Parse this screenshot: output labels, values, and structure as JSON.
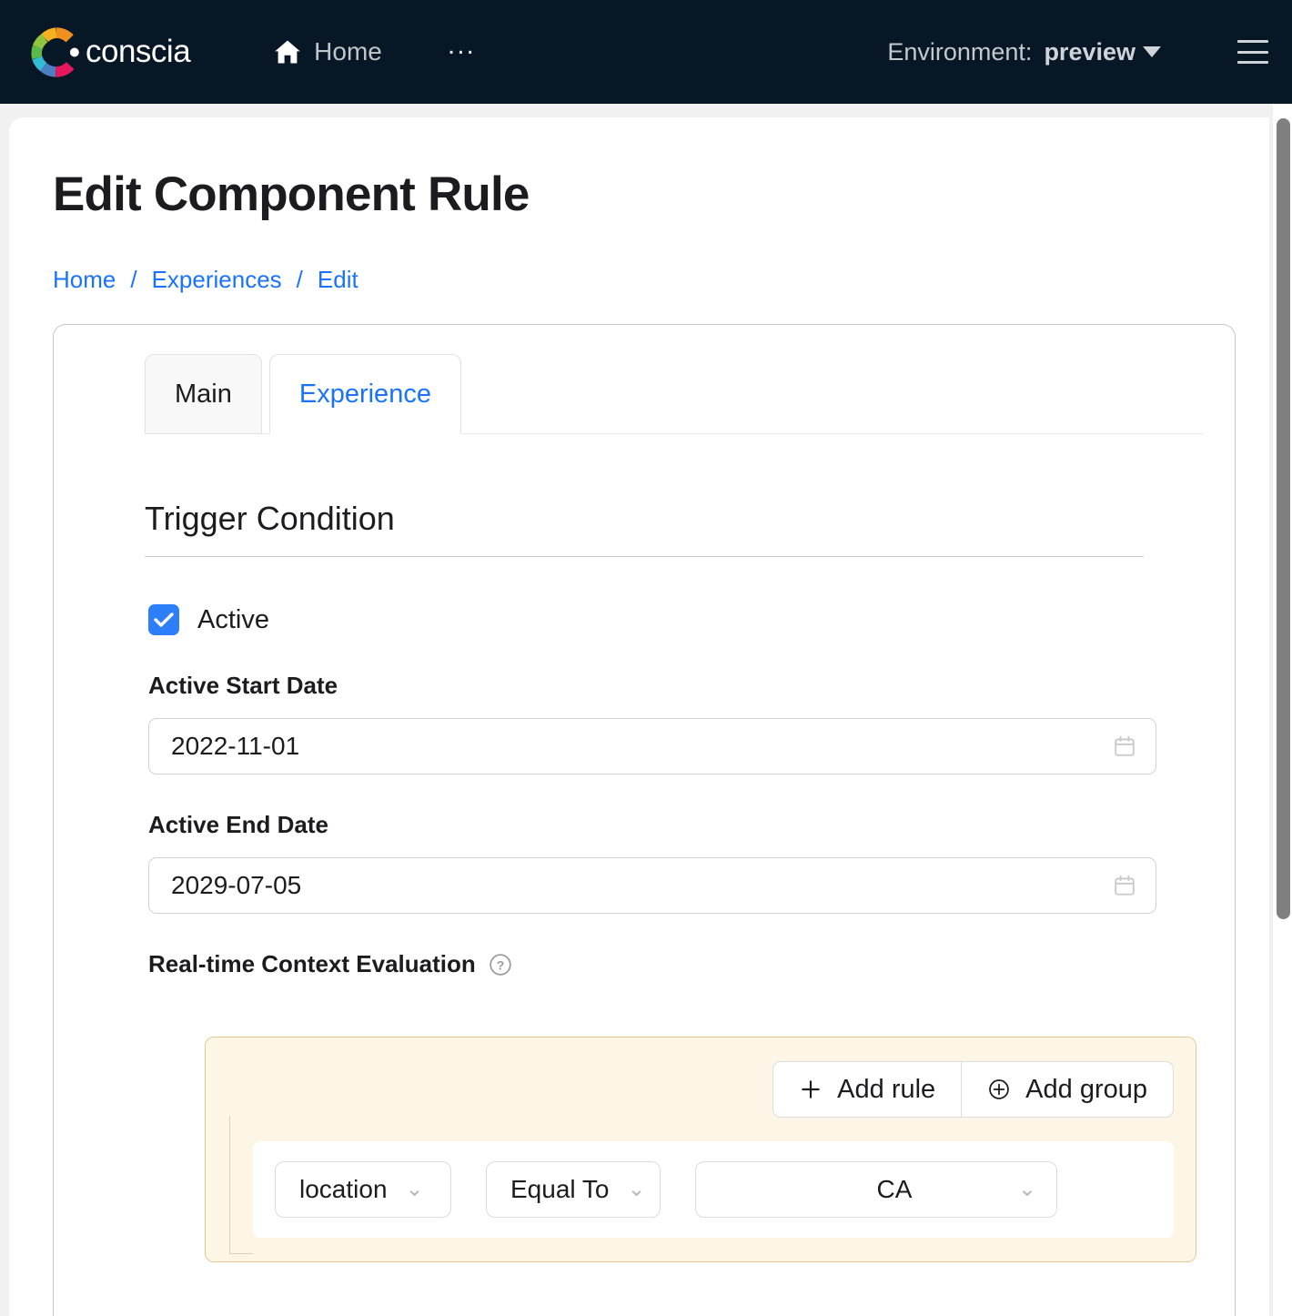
{
  "topnav": {
    "brand_name": "conscia",
    "home_label": "Home",
    "overflow_label": "...",
    "environment_label": "Environment:",
    "environment_value": "preview",
    "logo_colors": [
      "#f0901e",
      "#f4b223",
      "#8fc43f",
      "#5bb94a",
      "#32bcd3",
      "#4a7fc1",
      "#e6175c"
    ],
    "background": "#081725"
  },
  "page": {
    "title": "Edit Component Rule",
    "breadcrumb": [
      {
        "label": "Home"
      },
      {
        "label": "Experiences"
      },
      {
        "label": "Edit"
      }
    ],
    "breadcrumb_separator": "/",
    "link_color": "#1a73ff"
  },
  "card": {
    "tabs": [
      {
        "label": "Main",
        "active": false
      },
      {
        "label": "Experience",
        "active": true
      }
    ],
    "section_title": "Trigger Condition",
    "active_checkbox": {
      "label": "Active",
      "checked": true,
      "color": "#2d7ff9"
    },
    "fields": [
      {
        "label": "Active Start Date",
        "value": "2022-11-01",
        "icon": "calendar-icon"
      },
      {
        "label": "Active End Date",
        "value": "2029-07-05",
        "icon": "calendar-icon"
      }
    ],
    "context_evaluation": {
      "label": "Real-time Context Evaluation",
      "help_icon": "help-circle-icon",
      "group_background": "#fdf6e7",
      "group_border": "#e6c98f",
      "buttons": [
        {
          "label": "Add rule",
          "icon": "plus-icon"
        },
        {
          "label": "Add group",
          "icon": "plus-circle-icon"
        }
      ],
      "rules": [
        {
          "field": "location",
          "operator": "Equal To",
          "value": "CA"
        }
      ]
    }
  },
  "scrollbar": {
    "thumb_color": "#7f7f7f"
  }
}
